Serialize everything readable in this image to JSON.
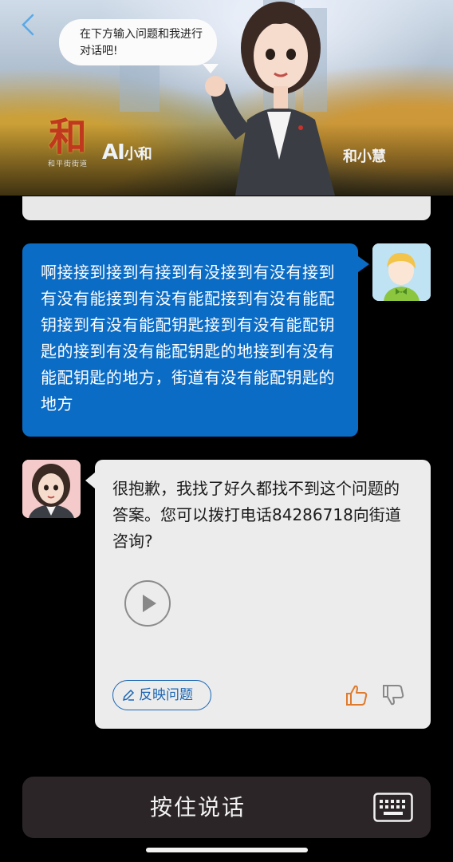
{
  "header": {
    "speech": "在下方输入问题和我进行对话吧!",
    "logo_glyph": "和",
    "logo_sub": "和平街街道",
    "logo_ai_main": "AI",
    "logo_ai_small": "小和",
    "assistant_name": "和小慧"
  },
  "messages": [
    {
      "role": "user",
      "text": "啊接接到接到有接到有没接到有没有接到有没有能接到有没有能配接到有没有能配钥接到有没有能配钥匙接到有没有能配钥匙的接到有没有能配钥匙的地接到有没有能配钥匙的地方，街道有没有能配钥匙的地方"
    },
    {
      "role": "bot",
      "text": "很抱歉，我找了好久都找不到这个问题的答案。您可以拨打电话84286718向街道咨询?",
      "feedback_label": "反映问题"
    }
  ],
  "footer": {
    "voice_label": "按住说话"
  },
  "colors": {
    "user_bubble": "#0b6cc6",
    "bot_bubble": "#ececec",
    "feedback_accent": "#1a66b5",
    "thumb_up": "#e07a2c"
  },
  "icons": [
    "back-chevron-icon",
    "play-icon",
    "edit-pencil-icon",
    "thumb-up-icon",
    "thumb-down-icon",
    "keyboard-icon"
  ]
}
